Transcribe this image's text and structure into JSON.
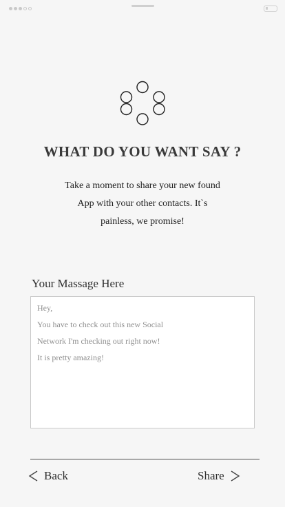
{
  "colors": {
    "background": "#f6f6f6",
    "text": "#2a2a2a",
    "placeholder": "#8f8f8f",
    "border": "#c8c8c8"
  },
  "status_bar": {
    "signal_icon": "signal-dots-icon",
    "battery_icon": "battery-icon"
  },
  "logo_icon": "circle-cluster-icon",
  "header": {
    "title": "WHAT DO YOU WANT SAY ?",
    "description_lines": [
      "Take a moment to share your new found",
      "App with your other contacts. It`s",
      "painless, we promise!"
    ]
  },
  "message": {
    "label": "Your Massage Here",
    "lines": [
      "Hey,",
      "You have to check out this new Social",
      "Network I'm checking out right now!",
      "It is pretty amazing!"
    ]
  },
  "footer": {
    "back_label": "Back",
    "share_label": "Share",
    "back_icon": "chevron-left-icon",
    "share_icon": "chevron-right-icon"
  }
}
